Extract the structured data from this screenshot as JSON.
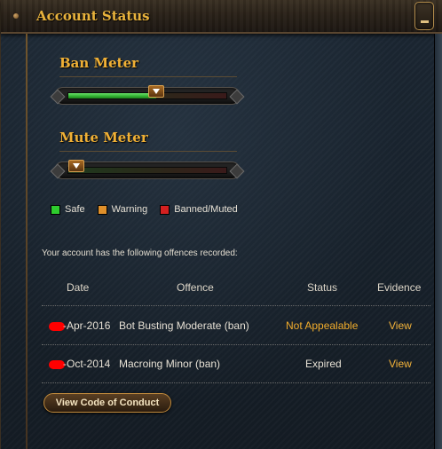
{
  "header": {
    "title": "Account Status"
  },
  "meters": {
    "ban": {
      "title": "Ban Meter",
      "level": 0.55
    },
    "mute": {
      "title": "Mute Meter",
      "level": 0.0
    }
  },
  "legend": [
    {
      "label": "Safe",
      "color": "#2ecc2e"
    },
    {
      "label": "Warning",
      "color": "#e0902a"
    },
    {
      "label": "Banned/Muted",
      "color": "#d42020"
    }
  ],
  "offences": {
    "intro": "Your account has the following offences recorded:",
    "headers": {
      "date": "Date",
      "offence": "Offence",
      "status": "Status",
      "evidence": "Evidence"
    },
    "rows": [
      {
        "date": "-Apr-2016",
        "offence": "Bot Busting Moderate (ban)",
        "status": "Not Appealable",
        "evidence": "View"
      },
      {
        "date": "-Oct-2014",
        "offence": "Macroing Minor (ban)",
        "status": "Expired",
        "evidence": "View"
      }
    ]
  },
  "actions": {
    "code_of_conduct": "View Code of Conduct"
  },
  "colors": {
    "accent": "#f0b035",
    "not_appealable": "#f2ad2c",
    "link": "#f2b23a"
  }
}
